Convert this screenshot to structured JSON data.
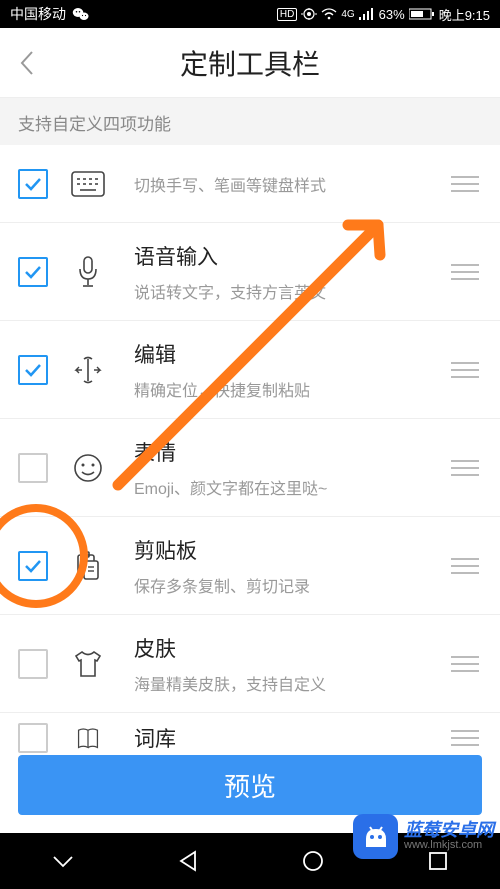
{
  "status": {
    "carrier": "中国移动",
    "hd": "HD",
    "net": "4G",
    "battery": "63%",
    "time": "晚上9:15"
  },
  "title": "定制工具栏",
  "subtitle": "支持自定义四项功能",
  "rows": [
    {
      "title": "",
      "desc": "切换手写、笔画等键盘样式",
      "checked": true
    },
    {
      "title": "语音输入",
      "desc": "说话转文字，支持方言英文",
      "checked": true
    },
    {
      "title": "编辑",
      "desc": "精确定位，快捷复制粘贴",
      "checked": true
    },
    {
      "title": "表情",
      "desc": "Emoji、颜文字都在这里哒~",
      "checked": false
    },
    {
      "title": "剪贴板",
      "desc": "保存多条复制、剪切记录",
      "checked": true
    },
    {
      "title": "皮肤",
      "desc": "海量精美皮肤，支持自定义",
      "checked": false
    },
    {
      "title": "词库",
      "desc": "",
      "checked": false
    }
  ],
  "preview": "预览",
  "watermark": {
    "line1": "蓝莓安卓网",
    "line2": "www.lmkjst.com"
  }
}
